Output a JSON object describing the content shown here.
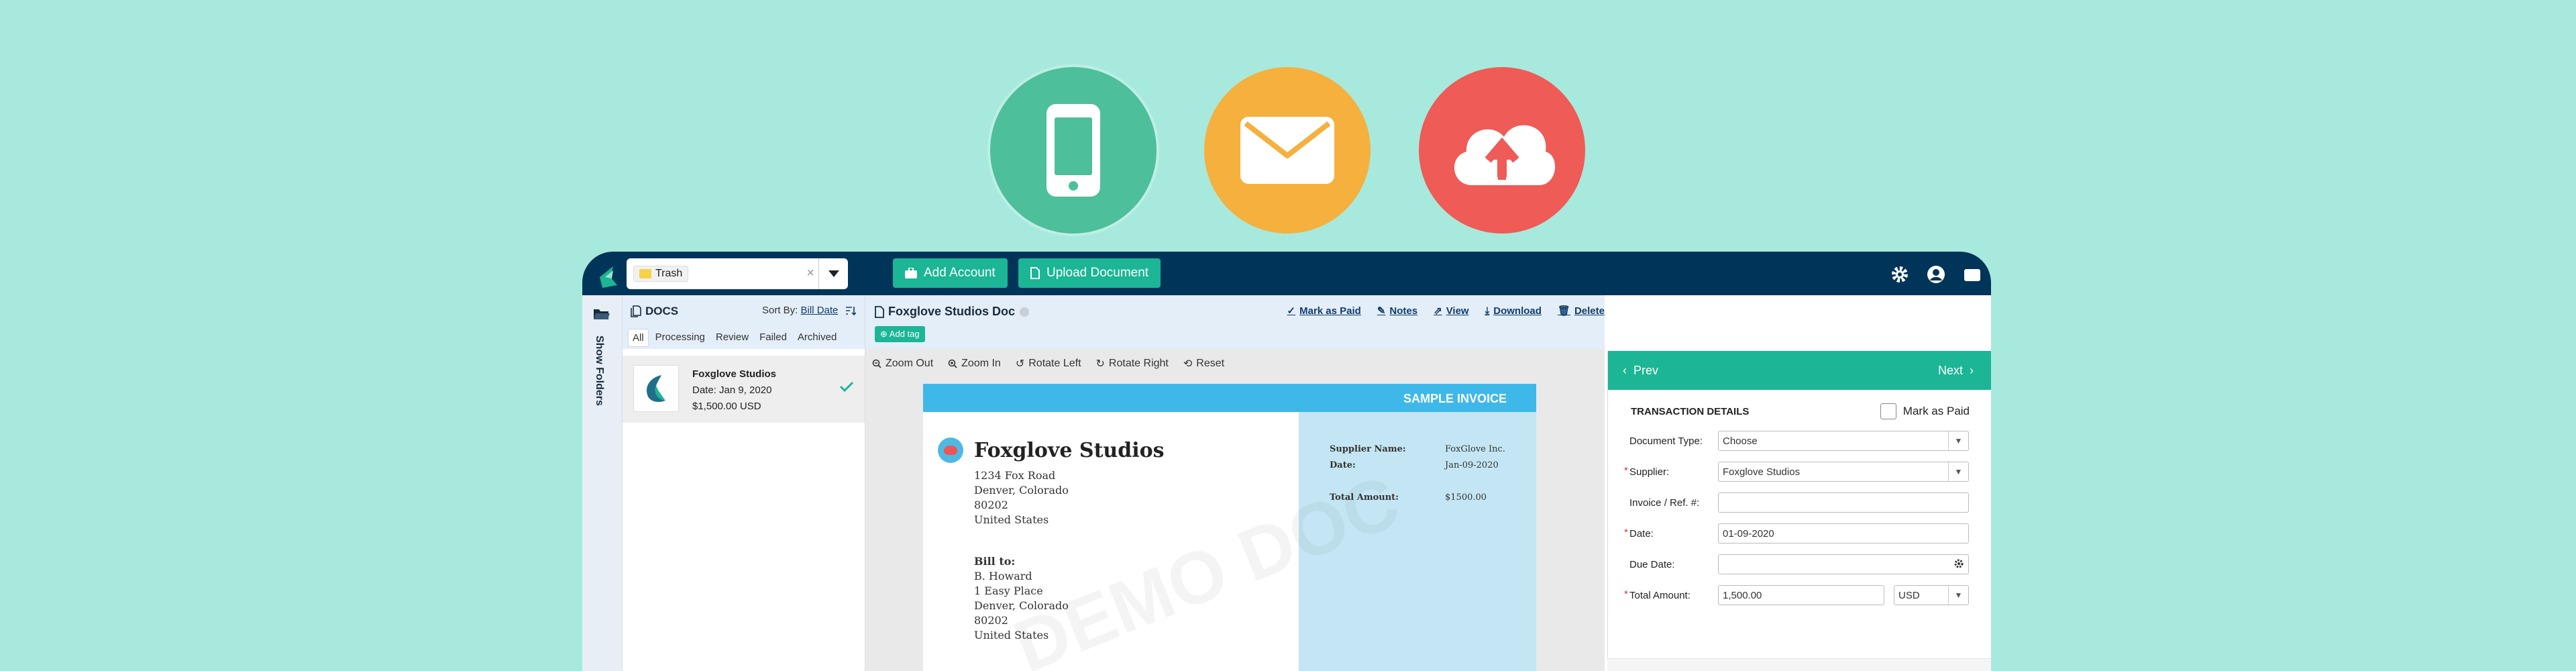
{
  "hero": {
    "icons": [
      "phone-icon",
      "mail-icon",
      "cloud-upload-icon"
    ],
    "colors": [
      "#4dbf9b",
      "#f5b03e",
      "#ef5b56"
    ]
  },
  "topbar": {
    "search_tag": "Trash",
    "add_account": "Add Account",
    "upload_document": "Upload Document"
  },
  "sidebar": {
    "show_folders": "Show Folders"
  },
  "docs": {
    "title": "DOCS",
    "sort_label": "Sort By: ",
    "sort_value": "Bill Date",
    "tabs": [
      "All",
      "Processing",
      "Review",
      "Failed",
      "Archived"
    ],
    "items": [
      {
        "name": "Foxglove Studios",
        "date": "Date: Jan 9, 2020",
        "amount": "$1,500.00 USD"
      }
    ]
  },
  "viewer": {
    "doc_name": "Foxglove Studios Doc",
    "add_tag": "Add tag",
    "toolbar": [
      "Zoom Out",
      "Zoom In",
      "Rotate Left",
      "Rotate Right",
      "Reset"
    ],
    "actions": [
      "Mark as Paid",
      "Notes",
      "View",
      "Download",
      "Delete"
    ]
  },
  "invoice": {
    "header": "SAMPLE INVOICE",
    "company": "Foxglove Studios",
    "address": [
      "1234 Fox Road",
      "Denver, Colorado",
      "80202",
      "United States"
    ],
    "bill_to_label": "Bill to:",
    "bill_to": [
      "B. Howard",
      "1 Easy Place",
      "Denver, Colorado",
      "80202",
      "United States"
    ],
    "supplier_name_label": "Supplier Name:",
    "supplier_name": "FoxGlove Inc.",
    "date_label": "Date:",
    "date": "Jan-09-2020",
    "total_label": "Total Amount:",
    "total": "$1500.00",
    "watermark": "DEMO DOC"
  },
  "panel": {
    "prev": "Prev",
    "next": "Next",
    "title": "TRANSACTION DETAILS",
    "mark_as_paid": "Mark as Paid",
    "fields": {
      "document_type": {
        "label": "Document Type:",
        "value": "Choose"
      },
      "supplier": {
        "label": "Supplier:",
        "value": "Foxglove Studios"
      },
      "invoice_ref": {
        "label": "Invoice / Ref. #:",
        "value": ""
      },
      "date": {
        "label": "Date:",
        "value": "01-09-2020"
      },
      "due_date": {
        "label": "Due Date:",
        "value": ""
      },
      "total_amount": {
        "label": "Total Amount:",
        "value": "1,500.00"
      },
      "currency": {
        "value": "USD"
      }
    }
  }
}
